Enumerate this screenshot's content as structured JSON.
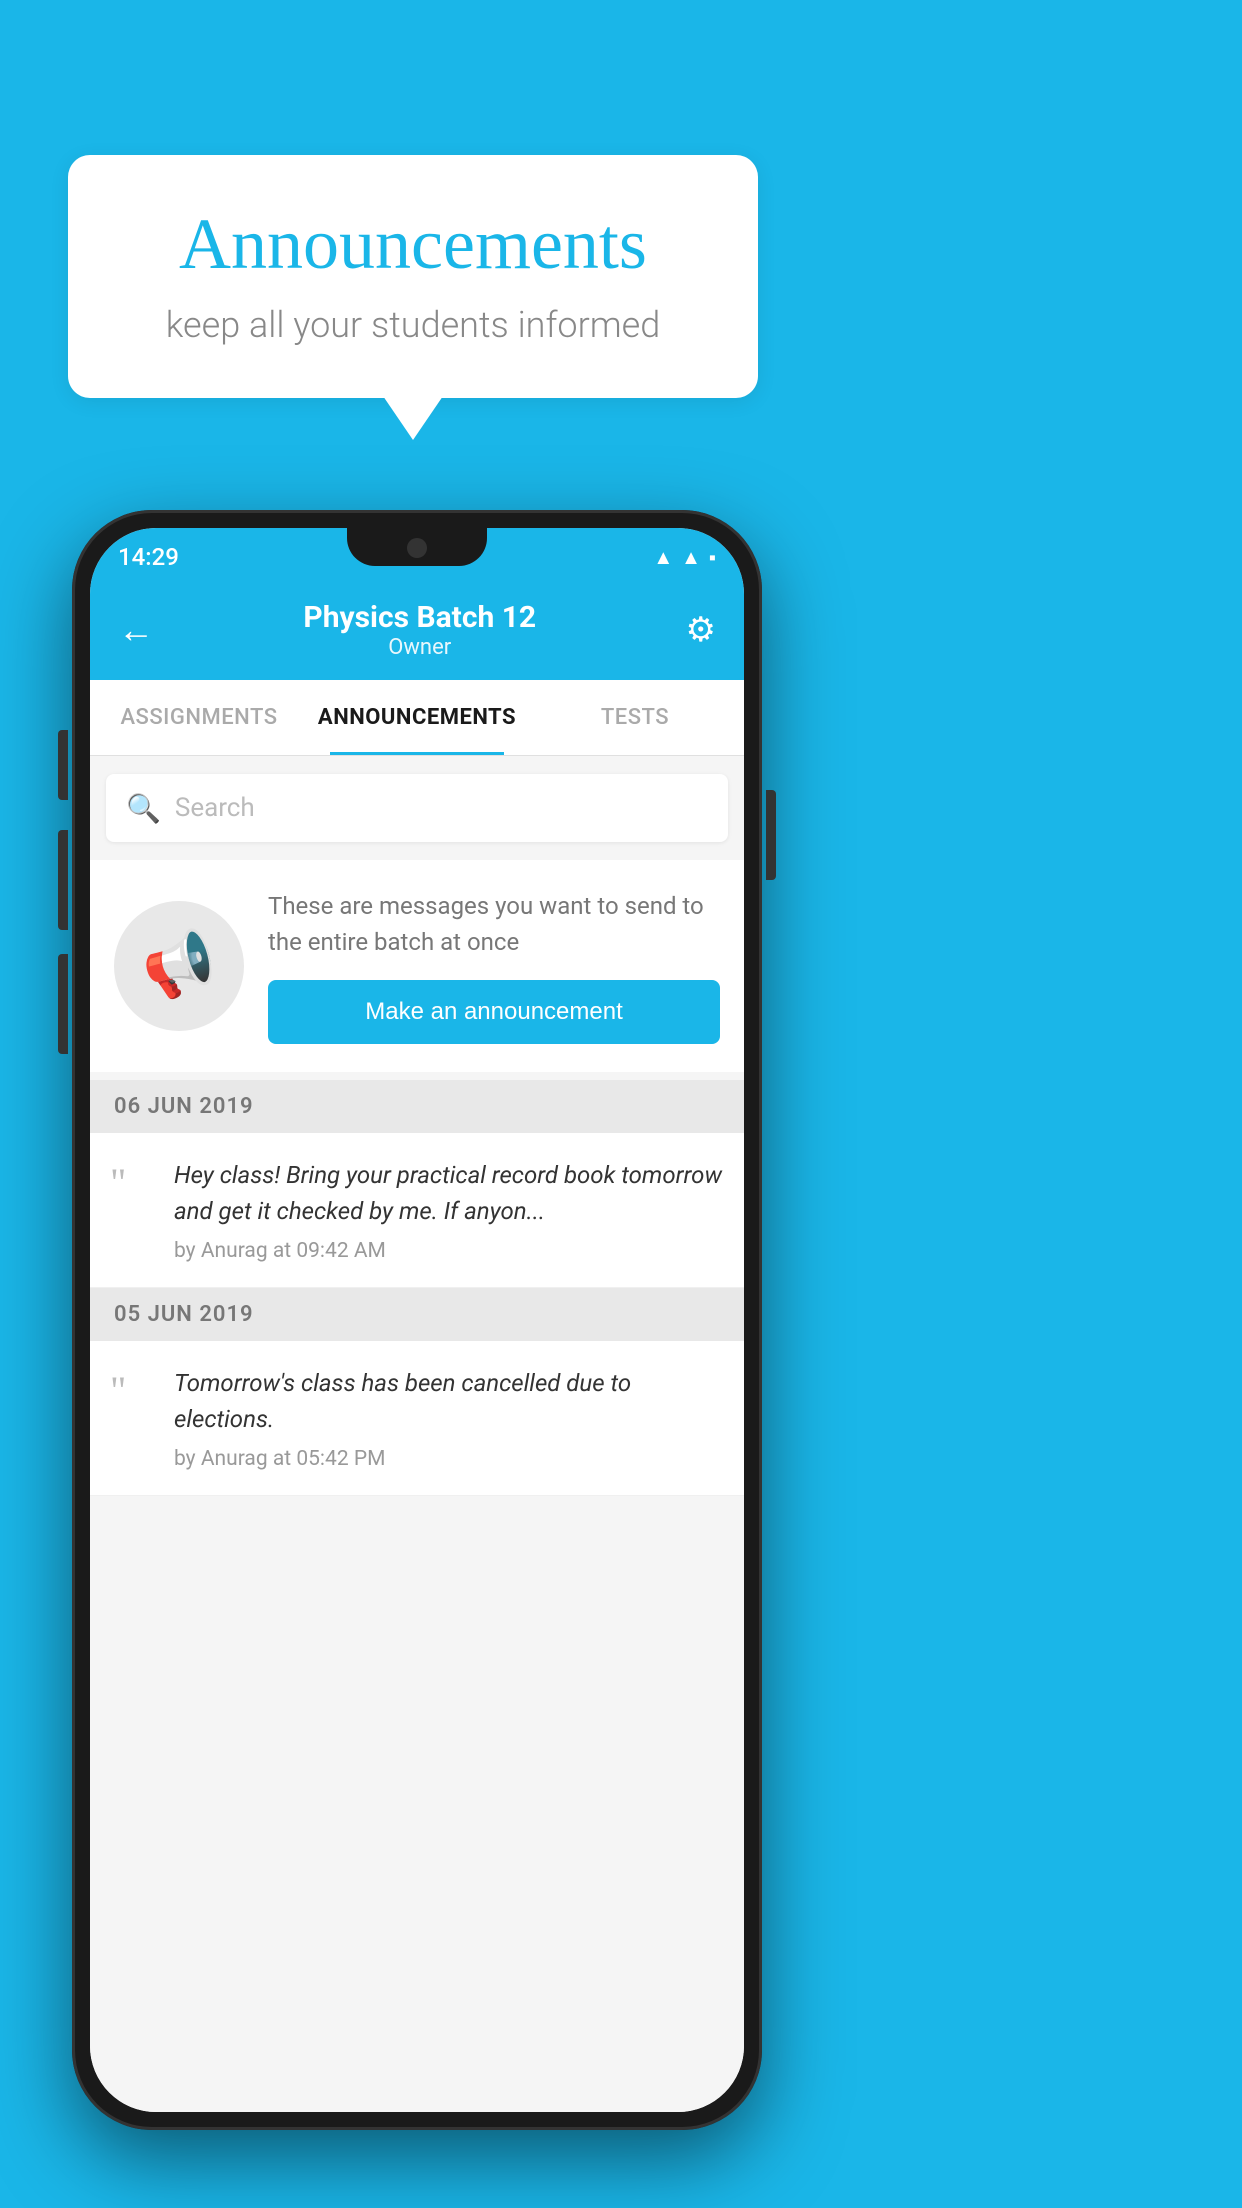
{
  "bubble": {
    "title": "Announcements",
    "subtitle": "keep all your students informed"
  },
  "statusBar": {
    "time": "14:29",
    "wifiIcon": "▲",
    "signalIcon": "▲",
    "batteryIcon": "▪"
  },
  "header": {
    "title": "Physics Batch 12",
    "subtitle": "Owner",
    "backLabel": "←",
    "gearLabel": "⚙"
  },
  "tabs": [
    {
      "label": "ASSIGNMENTS",
      "active": false
    },
    {
      "label": "ANNOUNCEMENTS",
      "active": true
    },
    {
      "label": "TESTS",
      "active": false
    }
  ],
  "search": {
    "placeholder": "Search"
  },
  "promoCard": {
    "description": "These are messages you want to send to the entire batch at once",
    "buttonLabel": "Make an announcement"
  },
  "announcements": [
    {
      "date": "06  JUN  2019",
      "items": [
        {
          "text": "Hey class! Bring your practical record book tomorrow and get it checked by me. If anyon...",
          "meta": "by Anurag at 09:42 AM"
        }
      ]
    },
    {
      "date": "05  JUN  2019",
      "items": [
        {
          "text": "Tomorrow's class has been cancelled due to elections.",
          "meta": "by Anurag at 05:42 PM"
        }
      ]
    }
  ],
  "colors": {
    "accent": "#1ab6e8",
    "background": "#1ab6e8",
    "white": "#ffffff"
  }
}
